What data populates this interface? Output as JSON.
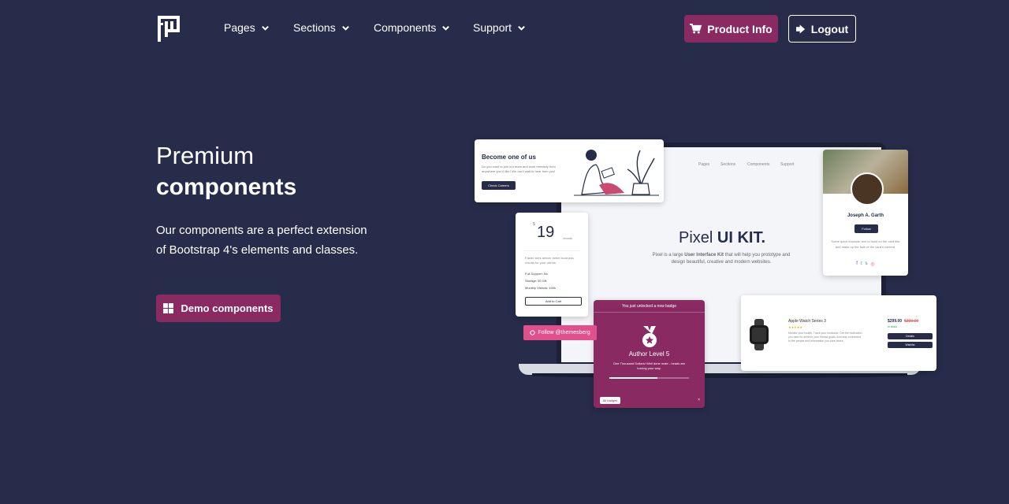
{
  "navbar": {
    "items": [
      {
        "label": "Pages"
      },
      {
        "label": "Sections"
      },
      {
        "label": "Components"
      },
      {
        "label": "Support"
      }
    ],
    "product_button": "Product Info",
    "logout_button": "Logout"
  },
  "hero": {
    "title_light": "Premium",
    "title_bold": "components",
    "description": "Our components are a perfect extension of Bootstrap 4's elements and classes.",
    "cta": "Demo components"
  },
  "mockup": {
    "nav": [
      "Pages",
      "Sections",
      "Components",
      "Support"
    ],
    "title_light": "Pixel ",
    "title_bold": "UI KIT.",
    "desc_pre": "Pixel is a large ",
    "desc_bold": "User Interface Kit",
    "desc_post": " that will help you prototype and design beautiful, creative and modern websites.",
    "careers": {
      "title": "Become one of us",
      "desc": "Do you want to join our team and work remotely from anywhere you'd like? We can't wait to hear from you!",
      "button": "Check Careers"
    },
    "pricing": {
      "currency": "$",
      "price": "19",
      "unit": "/month",
      "desc": "Faster sites deliver better business results for your clients.",
      "features": [
        "Full Support: No",
        "Storage: 50 GB",
        "Monthly Visitors: 400k"
      ],
      "button": "Add to Cart"
    },
    "profile": {
      "name": "Joseph A. Garth",
      "button": "Follow",
      "desc": "Some quick example text to build on the card title and make up the bulk of the card's content."
    },
    "watch": {
      "name": "Apple Watch Series 3",
      "rating": "★★★★★",
      "desc": "Monitor your health. Track your workouts. Get the motivation you need to achieve your fitness goals. And stay connected to the people and information you care about.",
      "price": "$299.00",
      "old_price": "$399.00",
      "stock": "In stock",
      "button_details": "Details",
      "button_wishlist": "Wishlist"
    },
    "badge": {
      "top": "You just unlocked a new badge",
      "title": "Author Level 5",
      "desc": "One Thousand Dollars! Well done mate - heads are turning your way.",
      "progress": 0.6,
      "button": "All badges",
      "close": "×"
    },
    "follow": "Follow @themesberg"
  },
  "colors": {
    "background": "#262c49",
    "accent": "#8a2a63",
    "pink": "#e2508b"
  },
  "icons": {
    "logo": "pixel-logo-icon",
    "cart": "cart-icon",
    "logout": "sign-out-icon",
    "grid": "grid-icon",
    "chevron": "chevron-down-icon"
  }
}
